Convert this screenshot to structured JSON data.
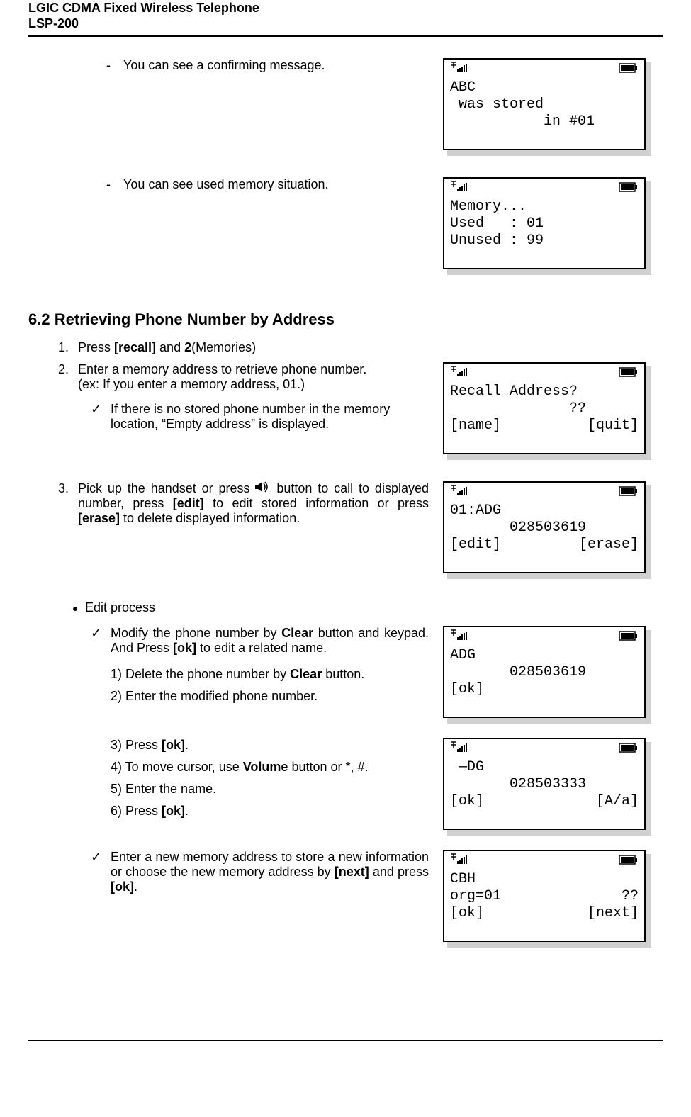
{
  "header": {
    "title": "LGIC CDMA Fixed Wireless Telephone",
    "model": "LSP-200"
  },
  "body": {
    "confirm_msg": "You can see a confirming message.",
    "memory_msg": "You can see used memory situation.",
    "section_heading": "6.2  Retrieving Phone Number by Address",
    "step1_pre": "Press ",
    "step1_bold": "[recall]",
    "step1_post": " and ",
    "step1_bold2": "2",
    "step1_post2": "(Memories)",
    "step2_a": "Enter a memory address to retrieve phone number.",
    "step2_b": "(ex: If you enter a memory address, 01.)",
    "step2_check": "If there is no stored phone number in the memory location, “Empty address” is displayed.",
    "step3_a": "Pick up the handset or press ",
    "step3_b": " button to call to displayed number, press ",
    "step3_bold_edit": "[edit]",
    "step3_c": " to edit stored information or press ",
    "step3_bold_erase": "[erase]",
    "step3_d": " to delete displayed information.",
    "edit_heading": "Edit process",
    "edit_modify_a": "Modify the phone number by ",
    "edit_modify_bold": "Clear",
    "edit_modify_b": " button and keypad. And Press ",
    "edit_modify_bold2": "[ok]",
    "edit_modify_c": " to edit a related name.",
    "sub1_a": "1) Delete the phone number by ",
    "sub1_bold": "Clear",
    "sub1_b": " button.",
    "sub2": "2) Enter the modified phone number.",
    "sub3_a": "3) Press ",
    "sub3_bold": "[ok]",
    "sub3_b": ".",
    "sub4_a": "4) To move cursor, use ",
    "sub4_bold": "Volume",
    "sub4_b": " button or *, #.",
    "sub5": "5) Enter the name.",
    "sub6_a": "6) Press ",
    "sub6_bold": "[ok]",
    "sub6_b": ".",
    "new_addr_a": "Enter a new memory address to store a new information or choose the new memory address by ",
    "new_addr_bold1": "[next]",
    "new_addr_b": " and press ",
    "new_addr_bold2": "[ok]",
    "new_addr_c": "."
  },
  "screens": {
    "s1": {
      "l1": "ABC",
      "l2": " was stored",
      "l3": "           in #01"
    },
    "s2": {
      "l1": "Memory...",
      "l2": "Used   : 01",
      "l3": "Unused : 99"
    },
    "s3": {
      "l1": "Recall Address?",
      "l2": "              ??",
      "soft_left": "[name]",
      "soft_right": "[quit]"
    },
    "s4": {
      "l1": "01:ADG",
      "l2": "       028503619",
      "soft_left": "[edit]",
      "soft_right": "[erase]"
    },
    "s5": {
      "l1": "ADG",
      "l2": "       028503619",
      "soft_left": "[ok]",
      "soft_right": ""
    },
    "s6": {
      "l1": " —DG",
      "l2": "       028503333",
      "soft_left": "[ok]",
      "soft_right": "[A/a]"
    },
    "s7": {
      "l1": "CBH",
      "l2_left": "org=01",
      "l2_right": "??",
      "soft_left": "[ok]",
      "soft_right": "[next]"
    }
  }
}
